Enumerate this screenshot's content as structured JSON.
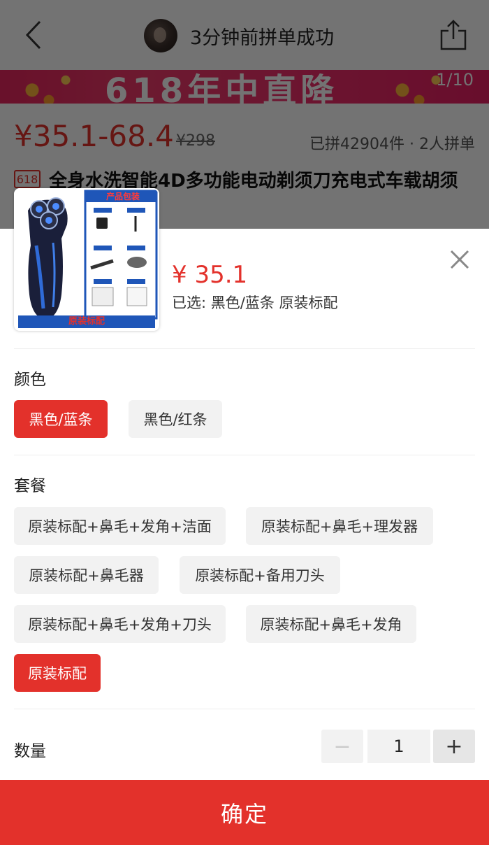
{
  "header": {
    "group_buy_status": "3分钟前拼单成功"
  },
  "banner": {
    "text": "618年中直降",
    "page_indicator": "1/10"
  },
  "product": {
    "price_range": "¥35.1-68.4",
    "original_price": "¥298",
    "sold_count": "已拼42904件 · 2人拼单",
    "badge": "618",
    "title": "全身水洗智能4D多功能电动剃须刀充电式车载胡须刀"
  },
  "thumbnail": {
    "package_title": "产品包装",
    "package_caption": "原装标配",
    "items": [
      "充电器头",
      "充电器头",
      "清洁刷",
      "刀头保护器",
      "说明书",
      "售后服务卡"
    ]
  },
  "sku_sheet": {
    "price": "¥ 35.1",
    "selected_summary": "已选: 黑色/蓝条 原装标配",
    "color": {
      "label": "颜色",
      "options": [
        "黑色/蓝条",
        "黑色/红条"
      ],
      "selected": "黑色/蓝条"
    },
    "package": {
      "label": "套餐",
      "options": [
        "原装标配+鼻毛+发角+洁面",
        "原装标配+鼻毛+理发器",
        "原装标配+鼻毛器",
        "原装标配+备用刀头",
        "原装标配+鼻毛+发角+刀头",
        "原装标配+鼻毛+发角",
        "原装标配"
      ],
      "selected": "原装标配"
    },
    "quantity": {
      "label": "数量",
      "value": "1",
      "minus_symbol": "−",
      "plus_symbol": "+"
    },
    "confirm_label": "确定"
  },
  "colors": {
    "accent": "#e3312b",
    "chip_bg": "#f2f2f2",
    "banner": "#ec2b64"
  }
}
